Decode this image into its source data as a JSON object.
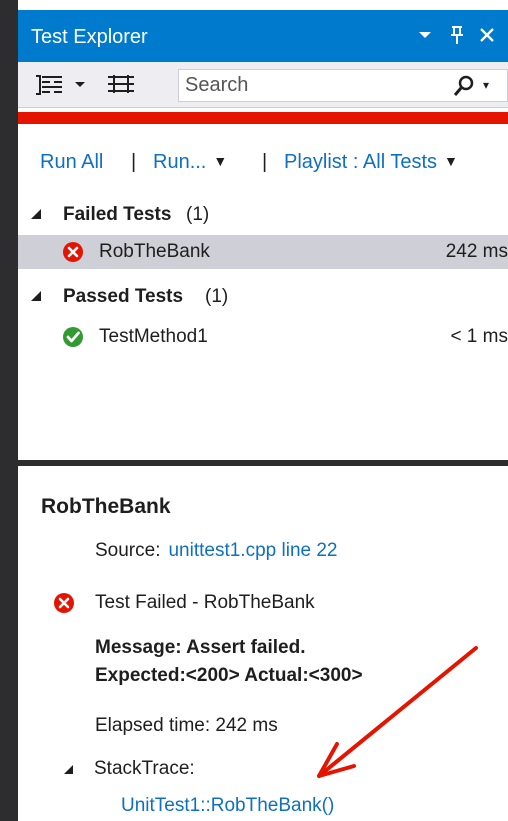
{
  "window": {
    "title": "Test Explorer",
    "title_buttons": [
      "dropdown-arrow-icon",
      "pin-icon",
      "close-icon"
    ]
  },
  "toolbar": {
    "group_by_icon": "group-by-icon",
    "dropdown_icon": "chevron-down-icon",
    "playlist_icon": "list-icon",
    "search_placeholder": "Search",
    "search_icon": "search-icon"
  },
  "status": {
    "color": "#e51400"
  },
  "commands": {
    "run_all": "Run All",
    "separator_1": "|",
    "run": "Run...",
    "separator_2": "|",
    "playlist": "Playlist : All Tests"
  },
  "tests": {
    "groups": [
      {
        "label": "Failed Tests",
        "count": "(1)",
        "items": [
          {
            "name": "RobTheBank",
            "time": "242 ms",
            "status": "failed",
            "icon": "failed-icon"
          }
        ]
      },
      {
        "label": "Passed Tests",
        "count": "(1)",
        "items": [
          {
            "name": "TestMethod1",
            "time": "< 1 ms",
            "status": "passed",
            "icon": "passed-icon"
          }
        ]
      }
    ]
  },
  "details": {
    "title": "RobTheBank",
    "source_label": "Source:",
    "source_link": "unittest1.cpp line 22",
    "failed_text": "Test Failed - RobTheBank",
    "message_line_1": "Message: Assert failed.",
    "message_line_2": "Expected:<200> Actual:<300>",
    "elapsed": "Elapsed time: 242 ms",
    "stacktrace_label": "StackTrace:",
    "stacktrace_link": "UnitTest1::RobTheBank()"
  },
  "colors": {
    "accent": "#007acc",
    "link": "#0e70c0",
    "failed": "#e51400",
    "passed": "#339933",
    "selected_row": "#cfcfd8",
    "annotation_arrow": "#e51400"
  }
}
